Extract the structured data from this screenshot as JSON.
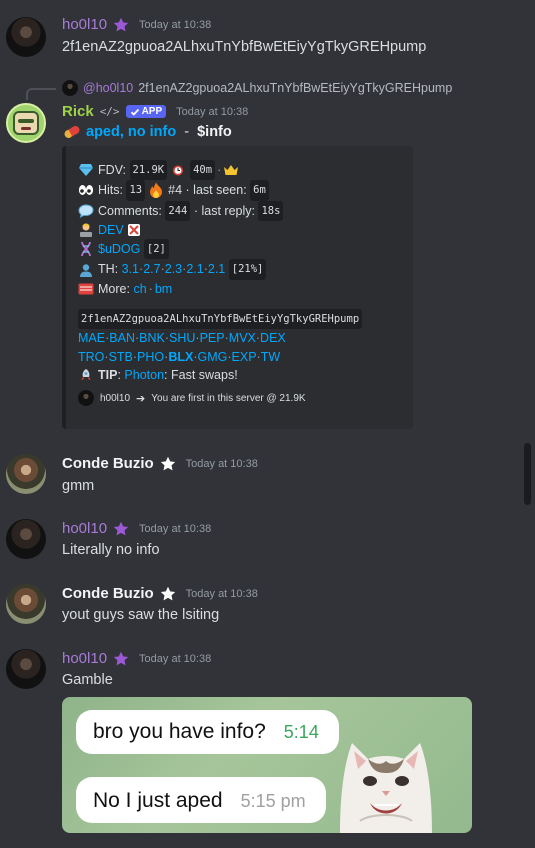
{
  "messages": [
    {
      "author": "ho0l10",
      "timestamp": "Today at 10:38",
      "text": "2f1enAZ2gpuoa2ALhxuTnYbfBwEtEiyYgTkyGREHpump"
    },
    {
      "reply": {
        "mention": "@ho0l10",
        "text": "2f1enAZ2gpuoa2ALhxuTnYbfBwEtEiyYgTkyGREHpump"
      },
      "author": "Rick",
      "badge": "APP",
      "dev_tag": "</>",
      "timestamp": "Today at 10:38",
      "title_link": "aped, no info",
      "title_suffix": " - ",
      "title_cmd": "$info"
    },
    {
      "author": "Conde Buzio",
      "timestamp": "Today at 10:38",
      "text": "gmm"
    },
    {
      "author": "ho0l10",
      "timestamp": "Today at 10:38",
      "text": "Literally no info"
    },
    {
      "author": "Conde Buzio",
      "timestamp": "Today at 10:38",
      "text": "yout guys saw the lsiting"
    },
    {
      "author": "ho0l10",
      "timestamp": "Today at 10:38",
      "text": "Gamble"
    }
  ],
  "embed": {
    "fdv_label": "FDV:",
    "fdv_value": "21.9K",
    "age_value": "40m",
    "hits_label": "Hits:",
    "hits_value": "13",
    "rank": "#4",
    "last_seen_label": "· last seen:",
    "last_seen_value": "6m",
    "comments_label": "Comments:",
    "comments_value": "244",
    "last_reply_label": "· last reply:",
    "last_reply_value": "18s",
    "dev_label": "DEV",
    "udog_label": "$uDOG",
    "udog_count": "[2]",
    "th_label": "TH:",
    "th_values": [
      "3.1",
      "2.7",
      "2.3",
      "2.1",
      "2.1"
    ],
    "th_total": "[21%]",
    "more_label": "More:",
    "more_links": [
      "ch",
      "bm"
    ],
    "contract": "2f1enAZ2gpuoa2ALhxuTnYbfBwEtEiyYgTkyGREHpump",
    "links_row1": [
      "MAE",
      "BAN",
      "BNK",
      "SHU",
      "PEP",
      "MVX",
      "DEX"
    ],
    "links_row2": [
      "TRO",
      "STB",
      "PHO",
      "BLX",
      "GMG",
      "EXP",
      "TW"
    ],
    "tip_label": "TIP",
    "tip_link": "Photon",
    "tip_text": ": Fast swaps!",
    "footer_user": "h00l10",
    "footer_text": "You are first in this server @ 21.9K"
  },
  "meme": {
    "bubble1": "bro you have info?",
    "time1": "5:14",
    "bubble2": "No I just aped",
    "time2": "5:15 pm"
  },
  "icons": [
    "crown-icon",
    "eyes-icon",
    "fire-icon",
    "speech-bubble-icon",
    "developer-icon",
    "dna-icon",
    "holder-icon",
    "card-icon",
    "rocket-icon",
    "pill-icon",
    "verified-check-icon",
    "star-badge-icon"
  ],
  "colors": {
    "background": "#313338",
    "embed_bg": "#2b2d31",
    "link": "#00a8fc",
    "purple_name": "#a77bd6",
    "rick_name": "#9dd24a",
    "app_badge": "#5865f2"
  }
}
